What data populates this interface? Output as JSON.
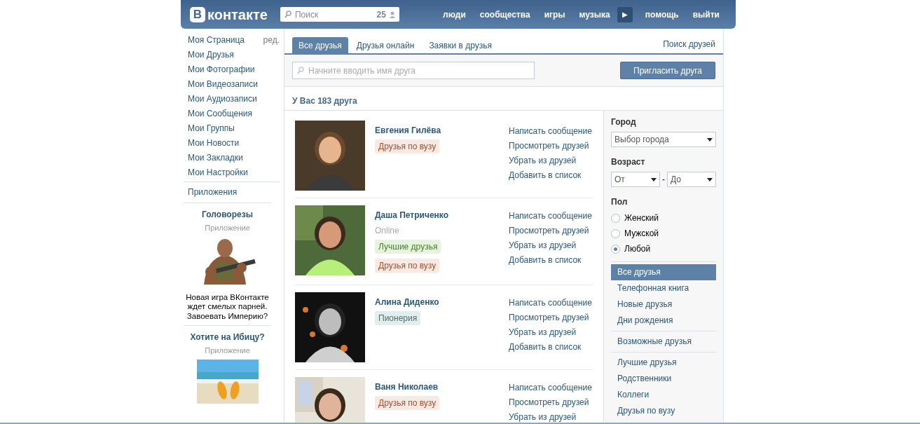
{
  "header": {
    "logo": {
      "letter": "В",
      "text": "контакте"
    },
    "search": {
      "placeholder": "Поиск",
      "count": "25"
    },
    "nav": [
      {
        "label": "люди",
        "kind": "link"
      },
      {
        "label": "сообщества",
        "kind": "link"
      },
      {
        "label": "игры",
        "kind": "link"
      },
      {
        "label": "музыка",
        "kind": "link"
      },
      {
        "label": "▶",
        "kind": "play"
      },
      {
        "label": "помощь",
        "kind": "link"
      },
      {
        "label": "выйти",
        "kind": "link"
      }
    ]
  },
  "sidebar": {
    "items": [
      {
        "label": "Моя Страница",
        "edit": "ред."
      },
      {
        "label": "Мои Друзья"
      },
      {
        "label": "Мои Фотографии"
      },
      {
        "label": "Мои Видеозаписи"
      },
      {
        "label": "Мои Аудиозаписи"
      },
      {
        "label": "Мои Сообщения"
      },
      {
        "label": "Мои Группы"
      },
      {
        "label": "Мои Новости"
      },
      {
        "label": "Мои Закладки"
      },
      {
        "label": "Мои Настройки"
      }
    ],
    "apps_link": "Приложения",
    "ads": [
      {
        "title": "Головорезы",
        "subtitle": "Приложение",
        "kind": "soldier",
        "text": "Новая игра ВКонтакте ждет смелых парней. Завоевать Империю?"
      },
      {
        "title": "Хотите на Ибицу?",
        "subtitle": "Приложение",
        "kind": "beach"
      }
    ]
  },
  "tabs": [
    {
      "label": "Все друзья",
      "selected": true
    },
    {
      "label": "Друзья онлайн",
      "selected": false
    },
    {
      "label": "Заявки в друзья",
      "selected": false
    }
  ],
  "find_friends": "Поиск друзей",
  "friend_search": {
    "placeholder": "Начните вводить имя друга"
  },
  "invite_button": "Пригласить друга",
  "count_heading": "У Вас 183 друга",
  "friends": [
    {
      "name": "Евгения Гилёва",
      "tags": [
        {
          "label": "Друзья по вузу",
          "color": "#a4502e"
        }
      ],
      "actions": [
        "Написать сообщение",
        "Просмотреть друзей",
        "Убрать из друзей",
        "Добавить в список"
      ]
    },
    {
      "name": "Даша Петриченко",
      "status": "Online",
      "tags": [
        {
          "label": "Лучшие друзья",
          "color": "#4d7a2a"
        },
        {
          "label": "Друзья по вузу",
          "color": "#a4502e"
        }
      ],
      "actions": [
        "Написать сообщение",
        "Просмотреть друзей",
        "Убрать из друзей",
        "Добавить в список"
      ]
    },
    {
      "name": "Алина Диденко",
      "tags": [
        {
          "label": "Пионерия",
          "color": "#4f6f6f"
        }
      ],
      "actions": [
        "Написать сообщение",
        "Просмотреть друзей",
        "Убрать из друзей",
        "Добавить в список"
      ]
    },
    {
      "name": "Ваня Николаев",
      "tags": [
        {
          "label": "Друзья по вузу",
          "color": "#a4502e"
        }
      ],
      "actions": [
        "Написать сообщение",
        "Просмотреть друзей",
        "Убрать из друзей"
      ]
    }
  ],
  "filters": {
    "city": {
      "label": "Город",
      "value": "Выбор города"
    },
    "age": {
      "label": "Возраст",
      "from": "От",
      "separator": "-",
      "to": "До"
    },
    "gender": {
      "label": "Пол",
      "options": [
        {
          "label": "Женский",
          "selected": false
        },
        {
          "label": "Мужской",
          "selected": false
        },
        {
          "label": "Любой",
          "selected": true
        }
      ]
    },
    "lists": [
      [
        {
          "label": "Все друзья",
          "selected": true
        },
        {
          "label": "Телефонная книга",
          "selected": false
        },
        {
          "label": "Новые друзья",
          "selected": false
        },
        {
          "label": "Дни рождения",
          "selected": false
        }
      ],
      [
        {
          "label": "Возможные друзья",
          "selected": false
        }
      ],
      [
        {
          "label": "Лучшие друзья",
          "selected": false
        },
        {
          "label": "Родственники",
          "selected": false
        },
        {
          "label": "Коллеги",
          "selected": false
        },
        {
          "label": "Друзья по вузу",
          "selected": false
        }
      ]
    ]
  }
}
